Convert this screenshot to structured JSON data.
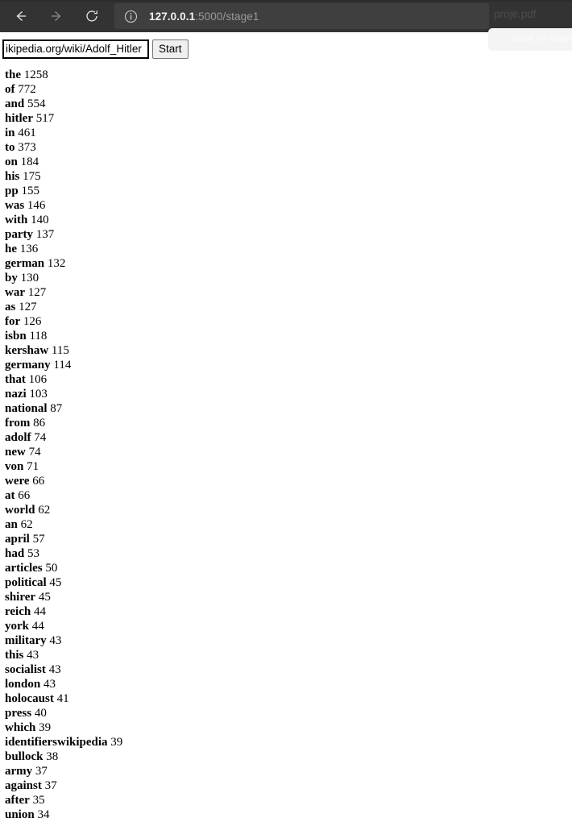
{
  "browser": {
    "back_icon": "arrow-left-icon",
    "forward_icon": "arrow-right-icon",
    "reload_icon": "reload-icon",
    "site_info_icon": "info-circle-icon",
    "url_host": "127.0.0.1",
    "url_rest": ":5000/stage1",
    "url_full": "127.0.0.1:5000/stage1",
    "download_item_label": "proje.pdf",
    "download_ghost_label": "local or shared",
    "chrome_bg": "#333333",
    "address_bar_bg": "#3f3f3f"
  },
  "form": {
    "url_value": "ikipedia.org/wiki/Adolf_Hitler",
    "url_placeholder": "",
    "start_label": "Start"
  },
  "results": {
    "rows": [
      {
        "word": "the",
        "count": "1258"
      },
      {
        "word": "of",
        "count": "772"
      },
      {
        "word": "and",
        "count": "554"
      },
      {
        "word": "hitler",
        "count": "517"
      },
      {
        "word": "in",
        "count": "461"
      },
      {
        "word": "to",
        "count": "373"
      },
      {
        "word": "on",
        "count": "184"
      },
      {
        "word": "his",
        "count": "175"
      },
      {
        "word": "pp",
        "count": "155"
      },
      {
        "word": "was",
        "count": "146"
      },
      {
        "word": "with",
        "count": "140"
      },
      {
        "word": "party",
        "count": "137"
      },
      {
        "word": "he",
        "count": "136"
      },
      {
        "word": "german",
        "count": "132"
      },
      {
        "word": "by",
        "count": "130"
      },
      {
        "word": "war",
        "count": "127"
      },
      {
        "word": "as",
        "count": "127"
      },
      {
        "word": "for",
        "count": "126"
      },
      {
        "word": "isbn",
        "count": "118"
      },
      {
        "word": "kershaw",
        "count": "115"
      },
      {
        "word": "germany",
        "count": "114"
      },
      {
        "word": "that",
        "count": "106"
      },
      {
        "word": "nazi",
        "count": "103"
      },
      {
        "word": "national",
        "count": "87"
      },
      {
        "word": "from",
        "count": "86"
      },
      {
        "word": "adolf",
        "count": "74"
      },
      {
        "word": "new",
        "count": "74"
      },
      {
        "word": "von",
        "count": "71"
      },
      {
        "word": "were",
        "count": "66"
      },
      {
        "word": "at",
        "count": "66"
      },
      {
        "word": "world",
        "count": "62"
      },
      {
        "word": "an",
        "count": "62"
      },
      {
        "word": "april",
        "count": "57"
      },
      {
        "word": "had",
        "count": "53"
      },
      {
        "word": "articles",
        "count": "50"
      },
      {
        "word": "political",
        "count": "45"
      },
      {
        "word": "shirer",
        "count": "45"
      },
      {
        "word": "reich",
        "count": "44"
      },
      {
        "word": "york",
        "count": "44"
      },
      {
        "word": "military",
        "count": "43"
      },
      {
        "word": "this",
        "count": "43"
      },
      {
        "word": "socialist",
        "count": "43"
      },
      {
        "word": "london",
        "count": "43"
      },
      {
        "word": "holocaust",
        "count": "41"
      },
      {
        "word": "press",
        "count": "40"
      },
      {
        "word": "which",
        "count": "39"
      },
      {
        "word": "identifierswikipedia",
        "count": "39"
      },
      {
        "word": "bullock",
        "count": "38"
      },
      {
        "word": "army",
        "count": "37"
      },
      {
        "word": "against",
        "count": "37"
      },
      {
        "word": "after",
        "count": "35"
      },
      {
        "word": "union",
        "count": "34"
      }
    ]
  }
}
